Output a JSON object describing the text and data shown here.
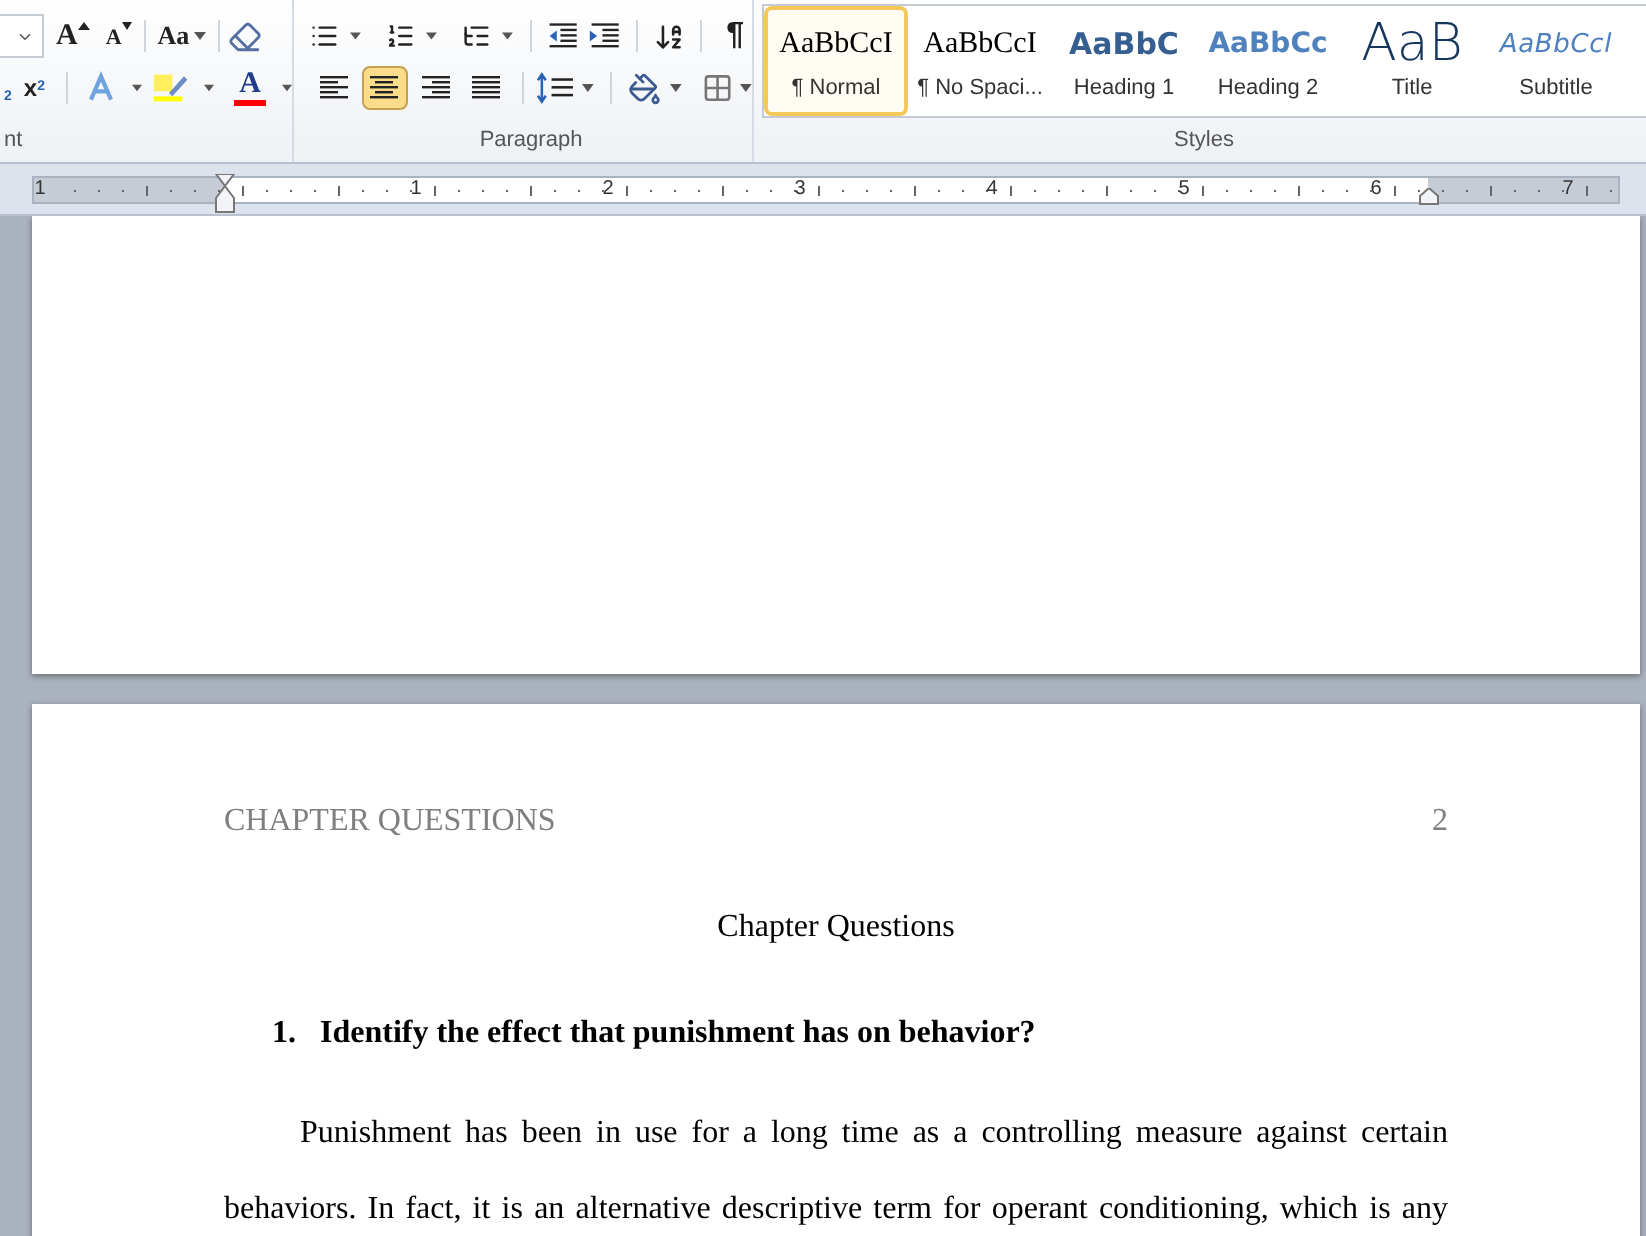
{
  "ribbon": {
    "font_group": {
      "label": "nt",
      "grow_font": "A",
      "shrink_font": "A",
      "change_case": "Aa",
      "subscript_mark": "2",
      "superscript": "x",
      "superscript_mark": "2",
      "font_color": "A"
    },
    "paragraph_group": {
      "label": "Paragraph",
      "show_marks": "¶",
      "alignments": [
        {
          "kind": "left",
          "selected": false
        },
        {
          "kind": "center",
          "selected": true
        },
        {
          "kind": "right",
          "selected": false
        },
        {
          "kind": "justify",
          "selected": false
        }
      ]
    },
    "styles_group": {
      "label": "Styles",
      "styles": [
        {
          "kind": "normal",
          "preview": "AaBbCcI",
          "name": "¶ Normal",
          "selected": true
        },
        {
          "kind": "normal",
          "preview": "AaBbCcI",
          "name": "¶ No Spaci...",
          "selected": false
        },
        {
          "kind": "heading1",
          "preview": "AaBbC",
          "name": "Heading 1",
          "selected": false
        },
        {
          "kind": "heading2",
          "preview": "AaBbCc",
          "name": "Heading 2",
          "selected": false
        },
        {
          "kind": "title",
          "preview": "AaB",
          "name": "Title",
          "selected": false
        },
        {
          "kind": "subtitle",
          "preview": "AaBbCcl",
          "name": "Subtitle",
          "selected": false
        }
      ]
    }
  },
  "ruler": {
    "labels": [
      "1",
      "1",
      "2",
      "3",
      "4",
      "5",
      "6",
      "7"
    ]
  },
  "document": {
    "header": "CHAPTER QUESTIONS",
    "page_number": "2",
    "title": "Chapter Questions",
    "question_number": "1.",
    "question": "Identify the effect that punishment has on behavior?",
    "paragraph": "Punishment has been in use for a long time as a controlling measure against certain behaviors. In fact, it is an alternative descriptive term for operant conditioning, which is any"
  }
}
